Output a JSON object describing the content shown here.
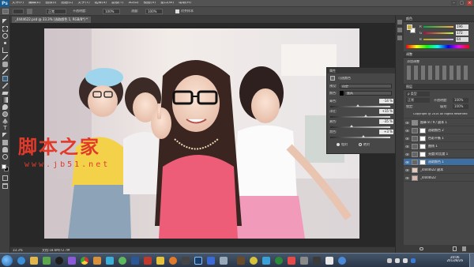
{
  "app": {
    "logo": "Ps"
  },
  "menu": [
    "文件(F)",
    "编辑(E)",
    "图像(I)",
    "图层(L)",
    "文字(Y)",
    "选择(S)",
    "滤镜(T)",
    "3D(D)",
    "视图(V)",
    "窗口(W)",
    "帮助(H)"
  ],
  "window_controls": {
    "minimize": "–",
    "maximize": "□",
    "close": "×"
  },
  "options": {
    "tool_preset": "",
    "mode": "正常",
    "opacity_label": "不透明度:",
    "opacity_value": "100%",
    "flow_label": "流量:",
    "flow_value": "100%",
    "align_label": "对齐样本"
  },
  "document_tab": "_4444622.psd @ 33.3% (选取颜色 1, RGB/8*) *",
  "watermark": {
    "title": "脚本之家",
    "url": "www.jb51.net"
  },
  "properties": {
    "title": "属性",
    "subtitle": "可选颜色",
    "preset_label": "预设:",
    "preset_value": "自定",
    "colors_label": "颜色:",
    "colors_value": "黑色",
    "rows": [
      {
        "label": "青色:",
        "value": "-14 %",
        "fill": 0.43
      },
      {
        "label": "洋红:",
        "value": "+15 %",
        "fill": 0.57
      },
      {
        "label": "黄色:",
        "value": "-35 %",
        "fill": 0.33
      },
      {
        "label": "黑色:",
        "value": "+3 %",
        "fill": 0.52
      }
    ],
    "method_relative": "相对",
    "method_absolute": "绝对"
  },
  "color_panel": {
    "tab": "颜色",
    "r_label": "R",
    "r_value": "196",
    "g_label": "G",
    "g_value": "172",
    "b_label": "B",
    "b_value": "64"
  },
  "adjust_panel": {
    "tab": "调整",
    "hint": "添加调整"
  },
  "layers_panel": {
    "tab": "图层",
    "kind_label": "ρ 类型",
    "blend_mode": "正常",
    "opacity_label": "不透明度:",
    "opacity_value": "100%",
    "lock_label": "锁定:",
    "fill_label": "填充:",
    "fill_value": "100%",
    "layers": [
      {
        "name": "Copyright @ 2014 All Rights Reserved"
      },
      {
        "name": "图章 8 / 9 / 副本 1"
      },
      {
        "name": "选取颜色 2"
      },
      {
        "name": "色彩平衡 1"
      },
      {
        "name": "曲线 1"
      },
      {
        "name": "亮度/对比度 1"
      },
      {
        "name": "选取颜色 1"
      },
      {
        "name": "_4444622 副本"
      },
      {
        "name": "_4444622"
      }
    ]
  },
  "status": {
    "zoom": "33.3%",
    "doc_size": "文档:18.6M/72.7M"
  },
  "taskbar": {
    "time": "20:06",
    "date": "2013/8/26"
  },
  "colors": {
    "accent": "#3f6ea0",
    "photo_bg": "#ede6e6",
    "watermark": "#e23a2a"
  }
}
